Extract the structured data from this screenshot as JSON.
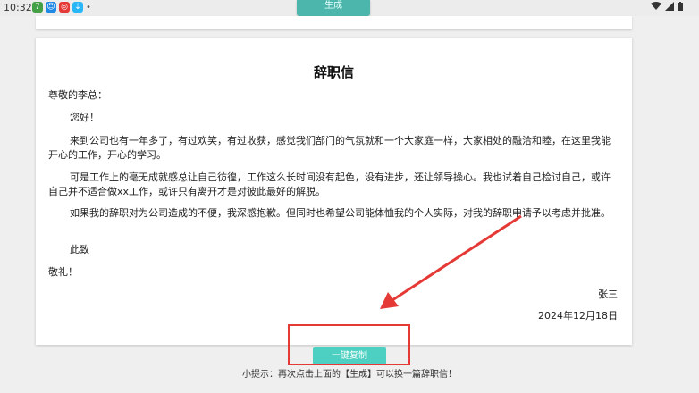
{
  "status": {
    "time": "10:32",
    "icon_names": [
      "app-7-icon",
      "app-blue-icon",
      "app-red-icon",
      "download-icon",
      "dot-icon"
    ],
    "icon_glyphs": [
      "7",
      "☺",
      "◎",
      "⇣",
      "•"
    ]
  },
  "toolbar": {
    "generate_label": "生成"
  },
  "letter": {
    "title": "辞职信",
    "greeting": "尊敬的李总：",
    "hello": "您好！",
    "paragraphs": [
      "来到公司也有一年多了，有过欢笑，有过收获，感觉我们部门的气氛就和一个大家庭一样，大家相处的融洽和睦，在这里我能开心的工作，开心的学习。",
      "可是工作上的毫无成就感总让自己彷徨，工作这么长时间没有起色，没有进步，还让领导操心。我也试着自己检讨自己，或许自己并不适合做xx工作，或许只有离开才是对彼此最好的解脱。",
      "如果我的辞职对为公司造成的不便，我深感抱歉。但同时也希望公司能体恤我的个人实际，对我的辞职申请予以考虑并批准。"
    ],
    "closing": "此致",
    "respect": "敬礼！",
    "signature": "张三",
    "date": "2024年12月18日"
  },
  "actions": {
    "copy_label": "一键复制"
  },
  "tip": "小提示：再次点击上面的【生成】可以换一篇辞职信！",
  "colors": {
    "accent": "#4dd0c2",
    "annotation": "#e53935"
  }
}
